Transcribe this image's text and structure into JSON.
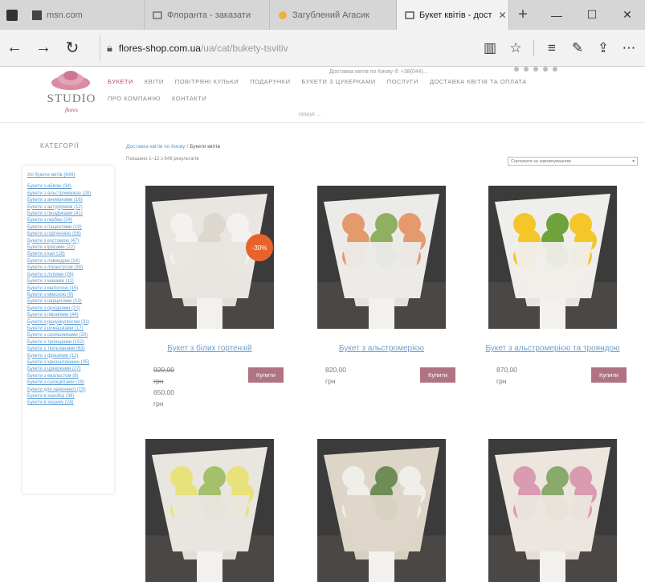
{
  "browser": {
    "tabs": [
      {
        "label": "msn.com",
        "icon": "msn-icon"
      },
      {
        "label": "Флоранта - заказати",
        "icon": "page-icon"
      },
      {
        "label": "Загублений Агасик",
        "icon": "game-icon"
      },
      {
        "label": "Букет квітів - дост",
        "icon": "page-icon",
        "active": true
      }
    ],
    "url_host": "flores-shop.com.ua",
    "url_path": "/ua/cat/bukety-tsvitiv"
  },
  "site": {
    "logo_text": "STUDIO",
    "logo_sub": "flores",
    "top_contact": "Доставка квітів по Києву  ✆ +38(044)...",
    "menu": [
      "БУКЕТИ",
      "КВІТИ",
      "ПОВІТРЯНІ КУЛЬКИ",
      "ПОДАРУНКИ",
      "БУКЕТИ З ЦУКЕРКАМИ",
      "ПОСЛУГИ",
      "ДОСТАВКА КВІТІВ ТА ОПЛАТА",
      "ПРО КОМПАНІЮ",
      "КОНТАКТИ"
    ],
    "search_hint": "пошук ..."
  },
  "sidebar": {
    "title": "КАТЕГОРІЇ",
    "first": "Усі букети квітів (649)",
    "categories": [
      "Букети з айвою (34)",
      "Букети з альстромерією (28)",
      "Букети з анемонами (16)",
      "Букети з антуріумом (12)",
      "Букети з гвоздиками (41)",
      "Букети з гербер (24)",
      "Букети з гіацинтами (19)",
      "Букети з гортензією (58)",
      "Букети з еустомою (47)",
      "Букети з ірисами (22)",
      "Букети з кал (18)",
      "Букети з лавандою (14)",
      "Букети з лізіантусом (39)",
      "Букети з ліліями (26)",
      "Букети з маками (11)",
      "Букети з матіолою (15)",
      "Букети з мімозою (9)",
      "Букети з нарцисами (13)",
      "Букети з орхідеями (21)",
      "Букети з півоніями (44)",
      "Букети з ранункулюсом (31)",
      "Букети з ромашками (17)",
      "Букети з соняшниками (20)",
      "Букети з трояндами (152)",
      "Букети з тюльпанами (63)",
      "Букети з фрезіями (12)",
      "Букети з хризантемами (35)",
      "Букети з цукерками (27)",
      "Букети з еваластом (8)",
      "Букети з сухоцвітами (19)",
      "Букети для нареченої (15)",
      "Букети в коробці (38)",
      "Букети в кошику (24)"
    ]
  },
  "breadcrumb": {
    "home": "Доставка квітів по Києву",
    "current": "Букети квітів"
  },
  "results_text": "Показано 1–12 з 649 результатів",
  "sort_label": "Сортувати за замовчуванням",
  "buy_label": "Купити",
  "products": [
    {
      "name": "Букет з білих гортензій",
      "price_old": "920,00 грн",
      "price": "650,00 грн",
      "badge": "-30%",
      "colors": {
        "paper": "#e9e6e2",
        "flower": "#f4f2ee",
        "accent": "#dcd8d0"
      }
    },
    {
      "name": "Букет з альстромерією",
      "price": "820,00 грн",
      "colors": {
        "paper": "#ecebe8",
        "flower": "#e59a6e",
        "accent": "#8fb060"
      }
    },
    {
      "name": "Букет з альстромерією та трояндою",
      "price": "870,00 грн",
      "colors": {
        "paper": "#efeeea",
        "flower": "#f4c62a",
        "accent": "#6ea23b"
      }
    },
    {
      "name": "",
      "price": "",
      "colors": {
        "paper": "#e9e6e0",
        "flower": "#e8e27a",
        "accent": "#a4c06a"
      }
    },
    {
      "name": "",
      "price": "",
      "colors": {
        "paper": "#ddd6c8",
        "flower": "#f0eee8",
        "accent": "#6f8c58"
      }
    },
    {
      "name": "",
      "price": "",
      "colors": {
        "paper": "#ede6df",
        "flower": "#d89bb0",
        "accent": "#8aa96d"
      }
    }
  ]
}
